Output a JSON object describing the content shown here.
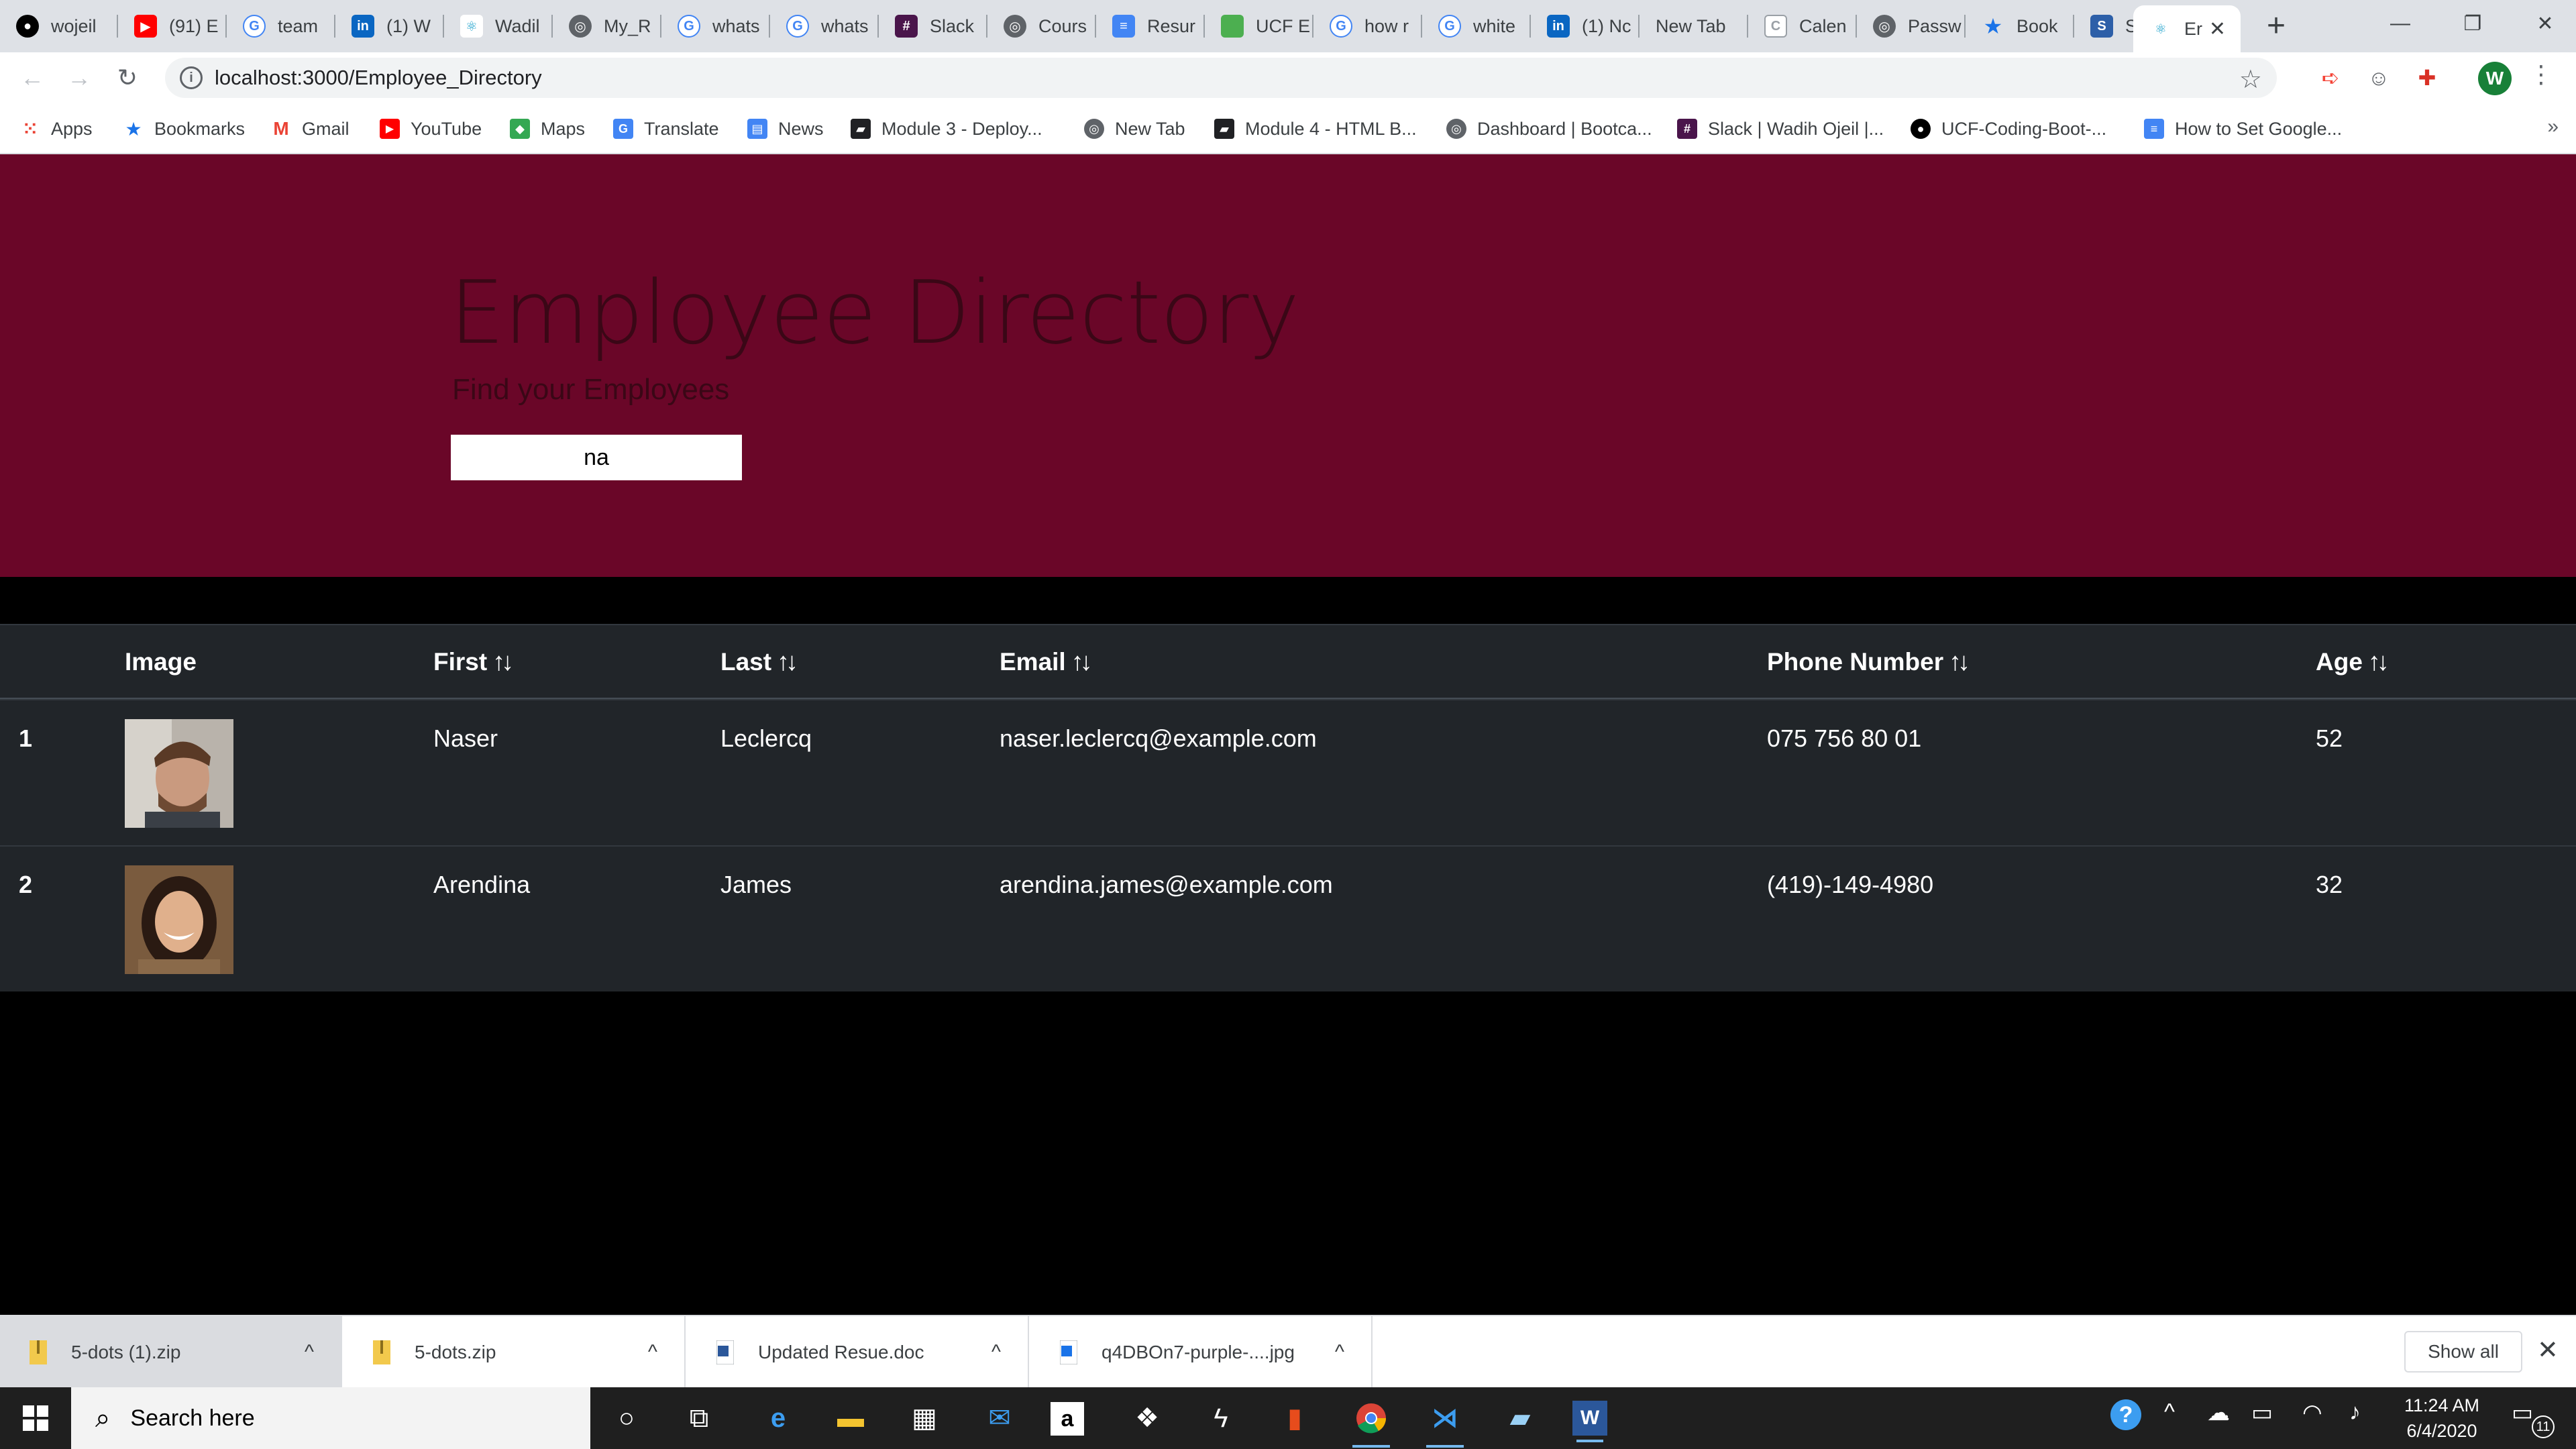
{
  "browser": {
    "tabs": [
      {
        "label": "wojeil",
        "icon": "github-icon",
        "color": "#000000"
      },
      {
        "label": "(91) E",
        "icon": "youtube-icon",
        "color": "#ff0000"
      },
      {
        "label": "team",
        "icon": "google-icon",
        "color": "#4285f4"
      },
      {
        "label": "(1) W",
        "icon": "linkedin-icon",
        "color": "#0a66c2"
      },
      {
        "label": "Wadil",
        "icon": "react-icon",
        "color": "#149eca"
      },
      {
        "label": "My_R",
        "icon": "globe-icon",
        "color": "#5f6368"
      },
      {
        "label": "whats",
        "icon": "google-icon",
        "color": "#4285f4"
      },
      {
        "label": "whats",
        "icon": "google-icon",
        "color": "#4285f4"
      },
      {
        "label": "Slack",
        "icon": "slack-icon",
        "color": "#4a154b"
      },
      {
        "label": "Cours",
        "icon": "globe-icon",
        "color": "#5f6368"
      },
      {
        "label": "Resur",
        "icon": "docs-icon",
        "color": "#4285f4"
      },
      {
        "label": "UCF E",
        "icon": "ucf-icon",
        "color": "#4caf50"
      },
      {
        "label": "how r",
        "icon": "google-icon",
        "color": "#4285f4"
      },
      {
        "label": "white",
        "icon": "google-icon",
        "color": "#4285f4"
      },
      {
        "label": "(1) Nc",
        "icon": "linkedin-icon",
        "color": "#0a66c2"
      },
      {
        "label": "New Tab",
        "icon": "",
        "color": ""
      },
      {
        "label": "Calen",
        "icon": "calendar-icon",
        "color": "#9aa0a6"
      },
      {
        "label": "Passw",
        "icon": "globe-icon",
        "color": "#5f6368"
      },
      {
        "label": "Book",
        "icon": "bookmark-star-icon",
        "color": "#1a73e8"
      },
      {
        "label": "Subtl",
        "icon": "sublime-icon",
        "color": "#2d5fa8"
      },
      {
        "label": "Er",
        "icon": "react-icon",
        "color": "#149eca"
      }
    ],
    "url": "localhost:3000/Employee_Directory",
    "profile_initial": "W"
  },
  "bookmarks": [
    {
      "label": "Apps",
      "icon": "apps-grid-icon",
      "color": "#ea4335"
    },
    {
      "label": "Bookmarks",
      "icon": "bookmark-star-icon",
      "color": "#1a73e8"
    },
    {
      "label": "Gmail",
      "icon": "gmail-icon",
      "color": "#ea4335"
    },
    {
      "label": "YouTube",
      "icon": "youtube-icon",
      "color": "#ff0000"
    },
    {
      "label": "Maps",
      "icon": "maps-icon",
      "color": "#34a853"
    },
    {
      "label": "Translate",
      "icon": "translate-icon",
      "color": "#4285f4"
    },
    {
      "label": "News",
      "icon": "news-icon",
      "color": "#4285f4"
    },
    {
      "label": "Module 3 - Deploy...",
      "icon": "book-icon",
      "color": "#202124"
    },
    {
      "label": "New Tab",
      "icon": "globe-icon",
      "color": "#5f6368"
    },
    {
      "label": "Module 4 - HTML B...",
      "icon": "book-icon",
      "color": "#202124"
    },
    {
      "label": "Dashboard | Bootca...",
      "icon": "globe-icon",
      "color": "#5f6368"
    },
    {
      "label": "Slack | Wadih Ojeil |...",
      "icon": "slack-icon",
      "color": "#4a154b"
    },
    {
      "label": "UCF-Coding-Boot-...",
      "icon": "github-icon",
      "color": "#000000"
    },
    {
      "label": "How to Set Google...",
      "icon": "docs-icon",
      "color": "#4285f4"
    }
  ],
  "page": {
    "title": "Employee Directory",
    "subtitle": "Find your Employees",
    "search_value": "na",
    "colors": {
      "jumbotron": "#6a0628",
      "table": "#212529"
    },
    "table": {
      "headers": [
        "Image",
        "First",
        "Last",
        "Email",
        "Phone Number",
        "Age"
      ],
      "rows": [
        {
          "index": "1",
          "first": "Naser",
          "last": "Leclercq",
          "email": "naser.leclercq@example.com",
          "phone": "075 756 80 01",
          "age": "52"
        },
        {
          "index": "2",
          "first": "Arendina",
          "last": "James",
          "email": "arendina.james@example.com",
          "phone": "(419)-149-4980",
          "age": "32"
        }
      ]
    }
  },
  "downloads": {
    "items": [
      "5-dots (1).zip",
      "5-dots.zip",
      "Updated Resue.doc",
      "q4DBOn7-purple-....jpg"
    ],
    "show_all": "Show all"
  },
  "taskbar": {
    "search_placeholder": "Search here",
    "time": "11:24 AM",
    "date": "6/4/2020",
    "notifications": "11"
  }
}
